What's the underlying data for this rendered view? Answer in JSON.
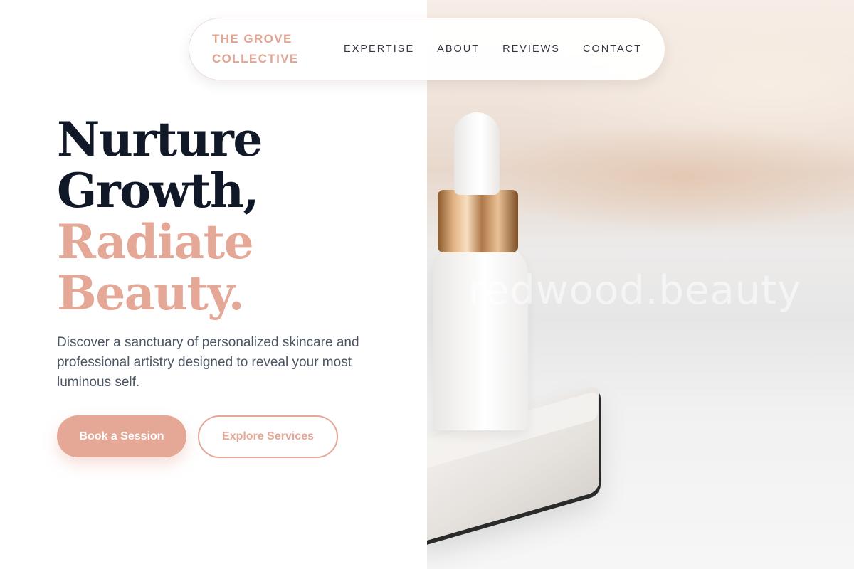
{
  "header": {
    "brand_line1": "THE GROVE",
    "brand_line2": "COLLECTIVE",
    "nav": [
      {
        "label": "EXPERTISE"
      },
      {
        "label": "ABOUT"
      },
      {
        "label": "REVIEWS"
      },
      {
        "label": "CONTACT"
      }
    ]
  },
  "hero": {
    "headline_line1": "Nurture",
    "headline_line2": "Growth,",
    "headline_line3": "Radiate",
    "headline_line4": "Beauty.",
    "description": "Discover a sanctuary of personalized skincare and professional artistry designed to reveal your most luminous self.",
    "primary_cta": "Book a Session",
    "secondary_cta": "Explore Services"
  },
  "image": {
    "watermark": "redwood.beauty"
  },
  "colors": {
    "accent": "#e5a796",
    "heading": "#111827",
    "body_text": "#4b5563"
  }
}
